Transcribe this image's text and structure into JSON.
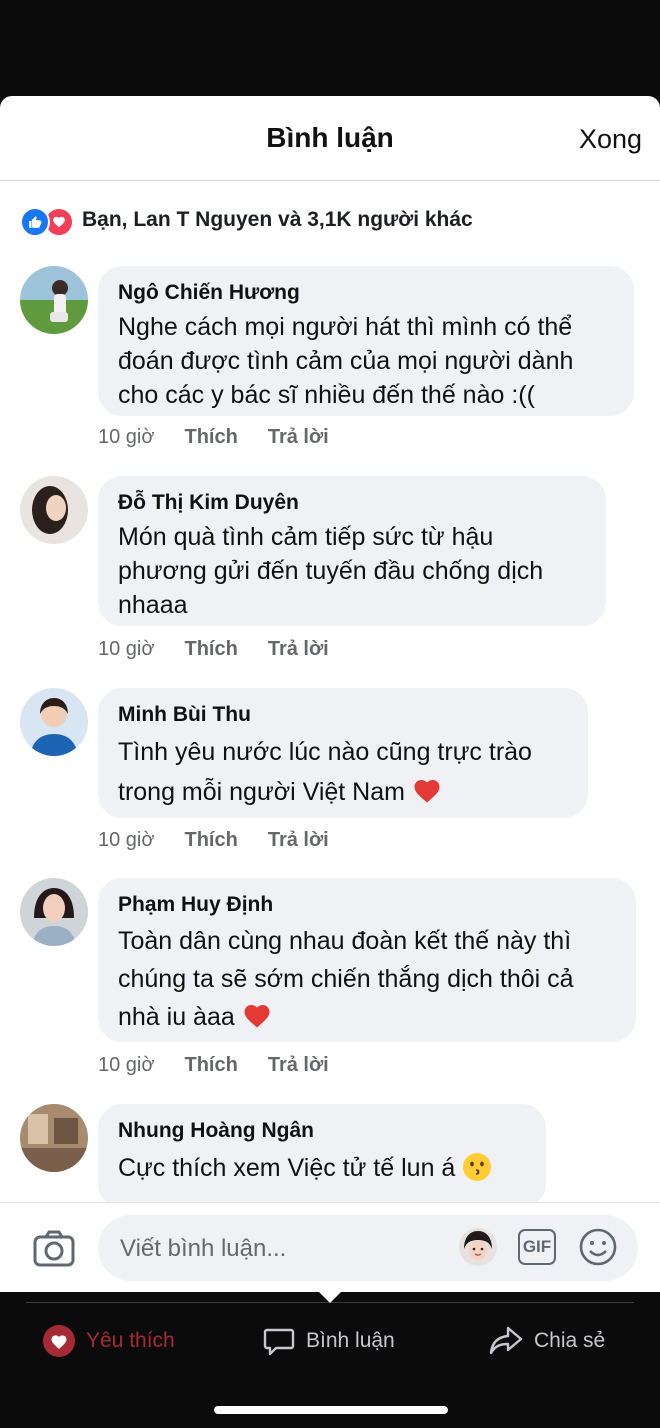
{
  "header": {
    "title": "Bình luận",
    "done_label": "Xong"
  },
  "reactions": {
    "summary": "Bạn, Lan T Nguyen và 3,1K người khác"
  },
  "comments": [
    {
      "name": "Ngô Chiến Hương",
      "text": "Nghe cách mọi người hát thì mình có thể đoán được tình cảm của mọi người dành cho các y bác sĩ nhiều đến thế nào :((",
      "time": "10 giờ",
      "like": "Thích",
      "reply": "Trả lời"
    },
    {
      "name": "Đỗ Thị Kim Duyên",
      "text": "Món quà tình cảm tiếp sức từ hậu phương gửi đến tuyến đầu chống dịch nhaaa",
      "time": "10 giờ",
      "like": "Thích",
      "reply": "Trả lời"
    },
    {
      "name": "Minh Bùi Thu",
      "text": "Tình yêu nước lúc nào cũng trực trào trong mỗi người Việt Nam",
      "time": "10 giờ",
      "like": "Thích",
      "reply": "Trả lời"
    },
    {
      "name": "Phạm Huy Định",
      "text": "Toàn dân cùng nhau đoàn kết thế này thì chúng ta sẽ sớm chiến thắng dịch thôi cả nhà iu àaa",
      "time": "10 giờ",
      "like": "Thích",
      "reply": "Trả lời"
    },
    {
      "name": "Nhung Hoàng Ngân",
      "text": "Cực thích xem Việc tử tế lun á"
    }
  ],
  "composer": {
    "placeholder": "Viết bình luận...",
    "gif_label": "GIF"
  },
  "tabbar": {
    "like": "Yêu thích",
    "comment": "Bình luận",
    "share": "Chia sẻ"
  },
  "colors": {
    "like_blue": "#1877f2",
    "love_red": "#f33e58",
    "bubble": "#f0f1f4",
    "heart": "#e53935"
  }
}
